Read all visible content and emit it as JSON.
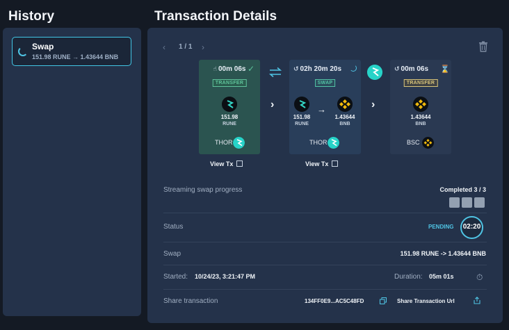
{
  "history": {
    "title": "History",
    "items": [
      {
        "title": "Swap",
        "subtitle": "151.98 RUNE → 1.43644 BNB",
        "icon": "spinner-icon"
      }
    ]
  },
  "details": {
    "title": "Transaction Details",
    "pager": {
      "label": "1 / 1"
    },
    "legs": [
      {
        "time": "00m 06s",
        "status_icon": "check-icon",
        "badge": "TRANSFER",
        "from_amount": "151.98",
        "from_ticker": "RUNE",
        "chain": "THOR",
        "view_tx": "View Tx"
      },
      {
        "time": "02h 20m 20s",
        "status_icon": "spinner-icon",
        "badge": "SWAP",
        "from_amount": "151.98",
        "from_ticker": "RUNE",
        "to_amount": "1.43644",
        "to_ticker": "BNB",
        "chain": "THOR",
        "view_tx": "View Tx"
      },
      {
        "time": "00m 06s",
        "status_icon": "hourglass-icon",
        "badge": "TRANSFER",
        "to_amount": "1.43644",
        "to_ticker": "BNB",
        "chain": "BSC"
      }
    ],
    "progress": {
      "label": "Streaming swap progress",
      "completed": "Completed 3 / 3",
      "done": 3,
      "total": 3
    },
    "status": {
      "label": "Status",
      "value": "PENDING",
      "timer": "02:20"
    },
    "swap": {
      "label": "Swap",
      "value": "151.98 RUNE -> 1.43644 BNB"
    },
    "started": {
      "label": "Started:",
      "value": "10/24/23, 3:21:47 PM"
    },
    "duration": {
      "label": "Duration:",
      "value": "05m 01s"
    },
    "share": {
      "label": "Share transaction",
      "hash": "134FF0E9...AC5C48FD",
      "url_label": "Share Transaction Url"
    }
  },
  "colors": {
    "accent": "#4fc4e4",
    "thor": "#27d3c8",
    "bnb": "#f0b90b",
    "panel": "#24324a",
    "background": "#141a24"
  }
}
